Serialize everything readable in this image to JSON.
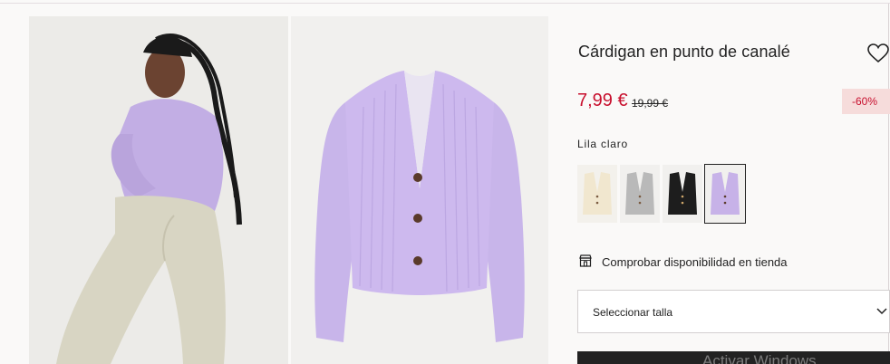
{
  "product": {
    "title": "Cárdigan en punto de canalé",
    "price": "7,99 €",
    "old_price": "19,99 €",
    "discount": "-60%",
    "selected_color": "Lila claro"
  },
  "colors": {
    "price_red": "#c8102e",
    "discount_bg": "#f6dcdb",
    "lilac": "#c2aee4"
  },
  "swatches": [
    {
      "name": "Beige",
      "color": "#f1eadb"
    },
    {
      "name": "Gris",
      "color": "#bdbdbd"
    },
    {
      "name": "Negro",
      "color": "#1f1f1f"
    },
    {
      "name": "Lila claro",
      "color": "#c7b2e8",
      "selected": true
    }
  ],
  "store": {
    "icon": "store-icon",
    "label": "Comprobar disponibilidad en tienda"
  },
  "size_select": {
    "label": "Seleccionar talla",
    "icon": "chevron-down-icon"
  },
  "overlay": {
    "watermark": "Activar Windows"
  }
}
